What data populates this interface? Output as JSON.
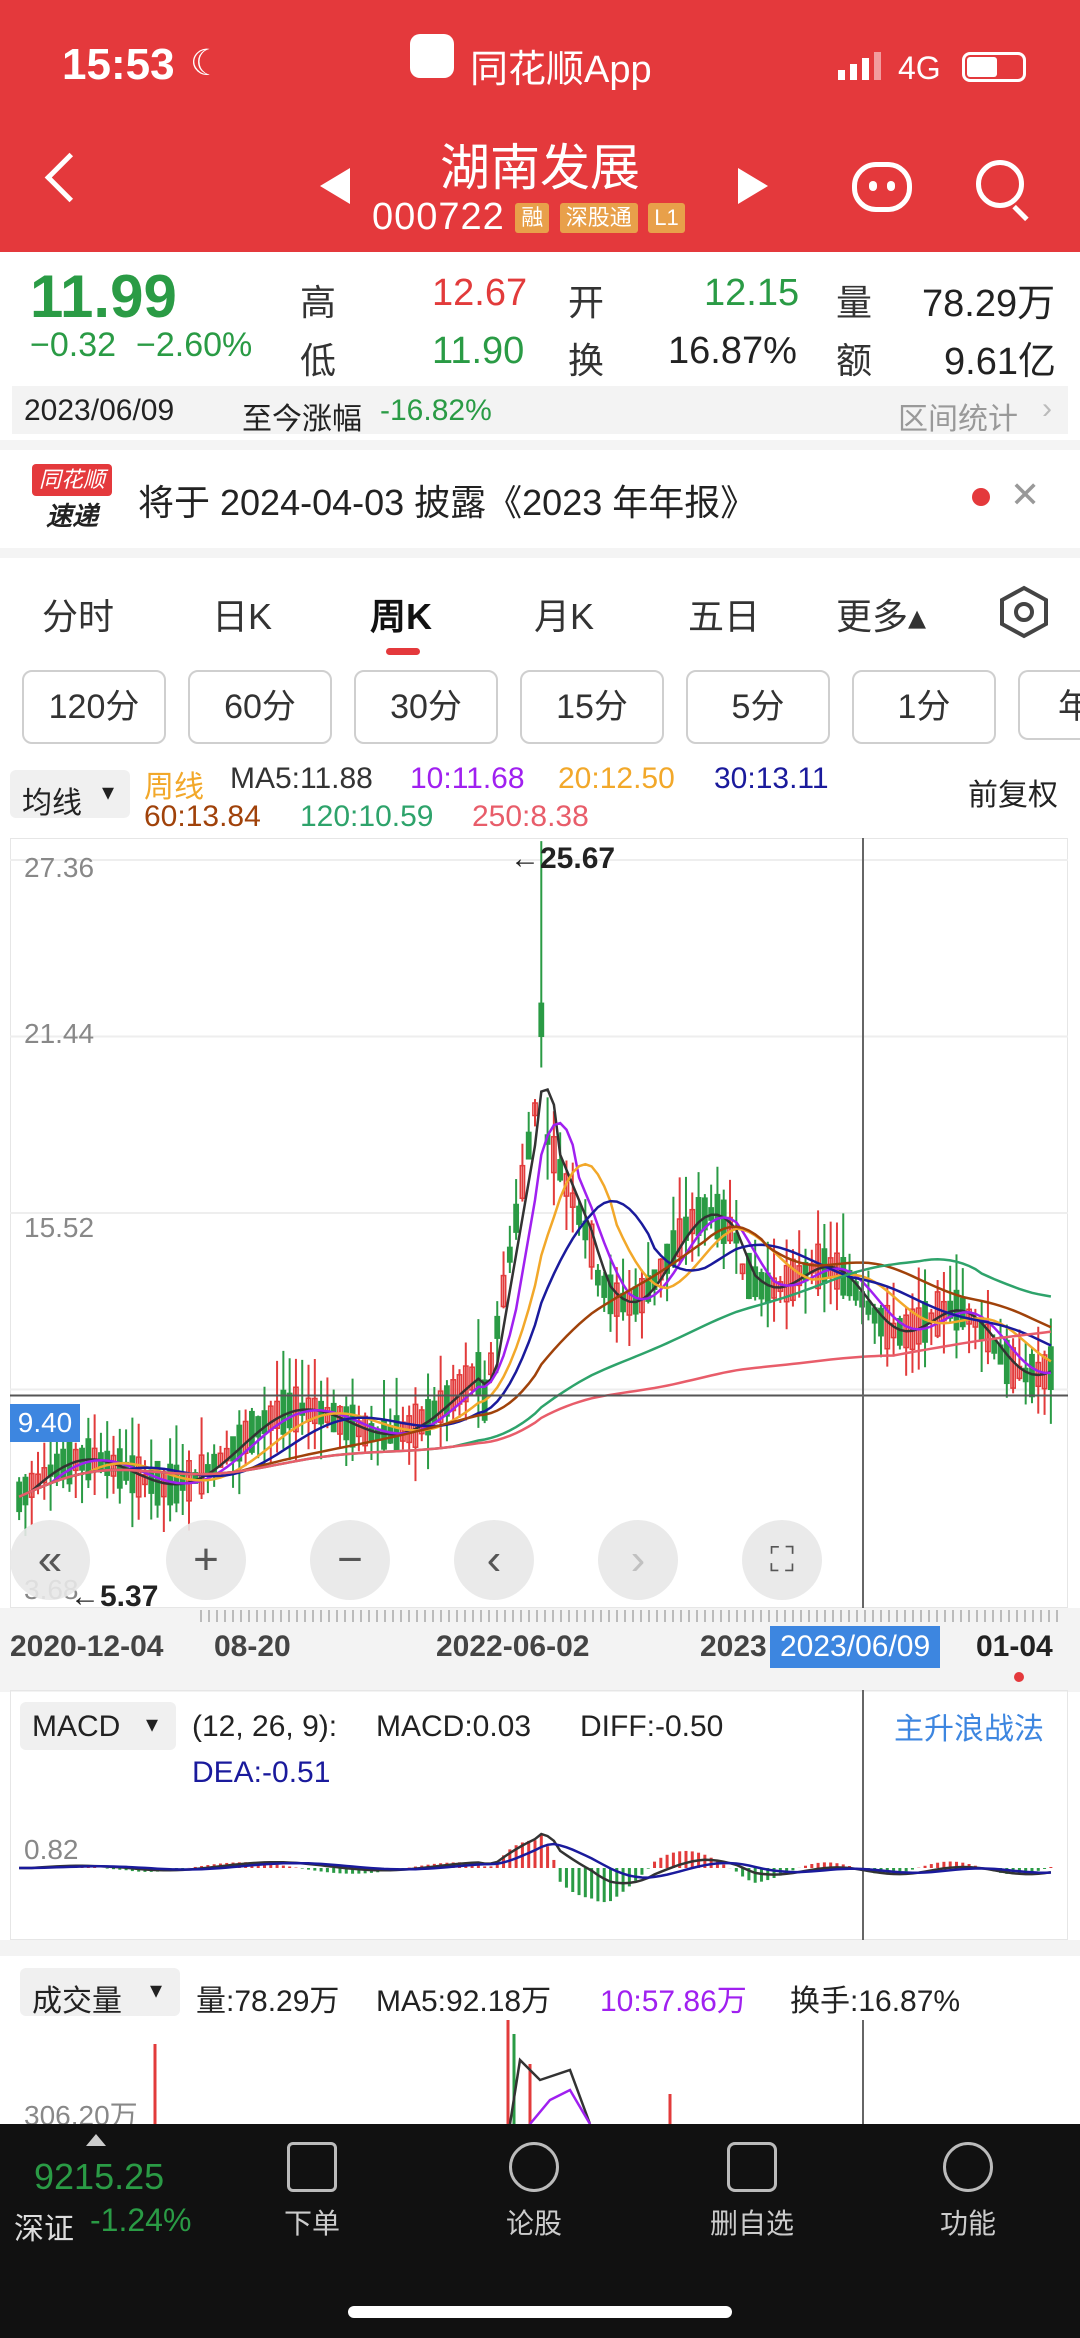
{
  "status": {
    "time": "15:53",
    "app_label": "同花顺App",
    "network": "4G"
  },
  "header": {
    "stock_name": "湖南发展",
    "stock_code": "000722",
    "tags": [
      "融",
      "深股通",
      "L1"
    ]
  },
  "quote": {
    "price": "11.99",
    "change": "−0.32",
    "change_pct": "−2.60%",
    "high_label": "高",
    "high": "12.67",
    "low_label": "低",
    "low": "11.90",
    "open_label": "开",
    "open": "12.15",
    "turnover_label": "换",
    "turnover": "16.87%",
    "volume_label": "量",
    "volume": "78.29万",
    "amount_label": "额",
    "amount": "9.61亿",
    "date": "2023/06/09",
    "range_label": "至今涨幅",
    "range_value": "-16.82%",
    "stats_link": "区间统计"
  },
  "notice": {
    "logo_top": "同花顺",
    "logo_bottom": "速递",
    "text": "将于 2024-04-03 披露《2023 年年报》"
  },
  "tabs": [
    "分时",
    "日K",
    "周K",
    "月K",
    "五日",
    "更多▴"
  ],
  "active_tab": "周K",
  "periods": [
    "120分",
    "60分",
    "30分",
    "15分",
    "5分",
    "1分",
    "年"
  ],
  "legend": {
    "indicator": "均线",
    "period": "周线",
    "ma5": "MA5:11.88",
    "ma10": "10:11.68",
    "ma20": "20:12.50",
    "ma30": "30:13.11",
    "ma60": "60:13.84",
    "ma120": "120:10.59",
    "ma250": "250:8.38",
    "adjust": "前复权"
  },
  "colors": {
    "header": "#e4393c",
    "up": "#e23b3b",
    "down": "#2a9b45",
    "ma5": "#333333",
    "ma10": "#a020f0",
    "ma20": "#f2a82a",
    "ma30": "#1a1a9c",
    "ma60": "#a0420a",
    "ma120": "#2ea36b",
    "ma250": "#e85d6a",
    "accent": "#3d86e0"
  },
  "main_chart": {
    "y_ticks": [
      "27.36",
      "21.44",
      "15.52",
      "3.68"
    ],
    "high_mark": "←25.67",
    "low_mark": "←5.37",
    "price_line": "9.40",
    "x_labels": [
      "2020-12-04",
      "08-20",
      "2022-06-02",
      "2023"
    ],
    "crosshair_date": "2023/06/09",
    "end_label": "01-04"
  },
  "macd": {
    "name": "MACD",
    "params": "(12, 26, 9):",
    "macd": "MACD:0.03",
    "diff": "DIFF:-0.50",
    "dea": "DEA:-0.51",
    "link": "主升浪战法",
    "level": "0.82"
  },
  "volume": {
    "name": "成交量",
    "vol": "量:78.29万",
    "ma5": "MA5:92.18万",
    "ma10": "10:57.86万",
    "turnover": "换手:16.87%",
    "tick": "306.20万"
  },
  "bottom": {
    "index_value": "9215.25",
    "index_name": "深证",
    "index_change": "-1.24%",
    "nav": [
      "下单",
      "论股",
      "删自选",
      "功能"
    ]
  },
  "chart_data": {
    "type": "candlestick",
    "x_labels": [
      "2020-12-04",
      "08-20",
      "2022-06-02",
      "2023",
      "01-04"
    ],
    "y_ticks": [
      27.36,
      21.44,
      15.52,
      3.68
    ],
    "period_high": 25.67,
    "period_low": 5.37,
    "current_price_line": 9.4,
    "series": [
      {
        "name": "MA5",
        "value": 11.88
      },
      {
        "name": "10",
        "value": 11.68
      },
      {
        "name": "20",
        "value": 12.5
      },
      {
        "name": "30",
        "value": 13.11
      },
      {
        "name": "60",
        "value": 13.84
      },
      {
        "name": "120",
        "value": 10.59
      },
      {
        "name": "250",
        "value": 8.38
      }
    ],
    "macd": {
      "params": [
        12,
        26,
        9
      ],
      "macd": 0.03,
      "diff": -0.5,
      "dea": -0.51
    },
    "volume": {
      "last": "78.29万",
      "ma5": "92.18万",
      "ma10": "57.86万"
    }
  }
}
